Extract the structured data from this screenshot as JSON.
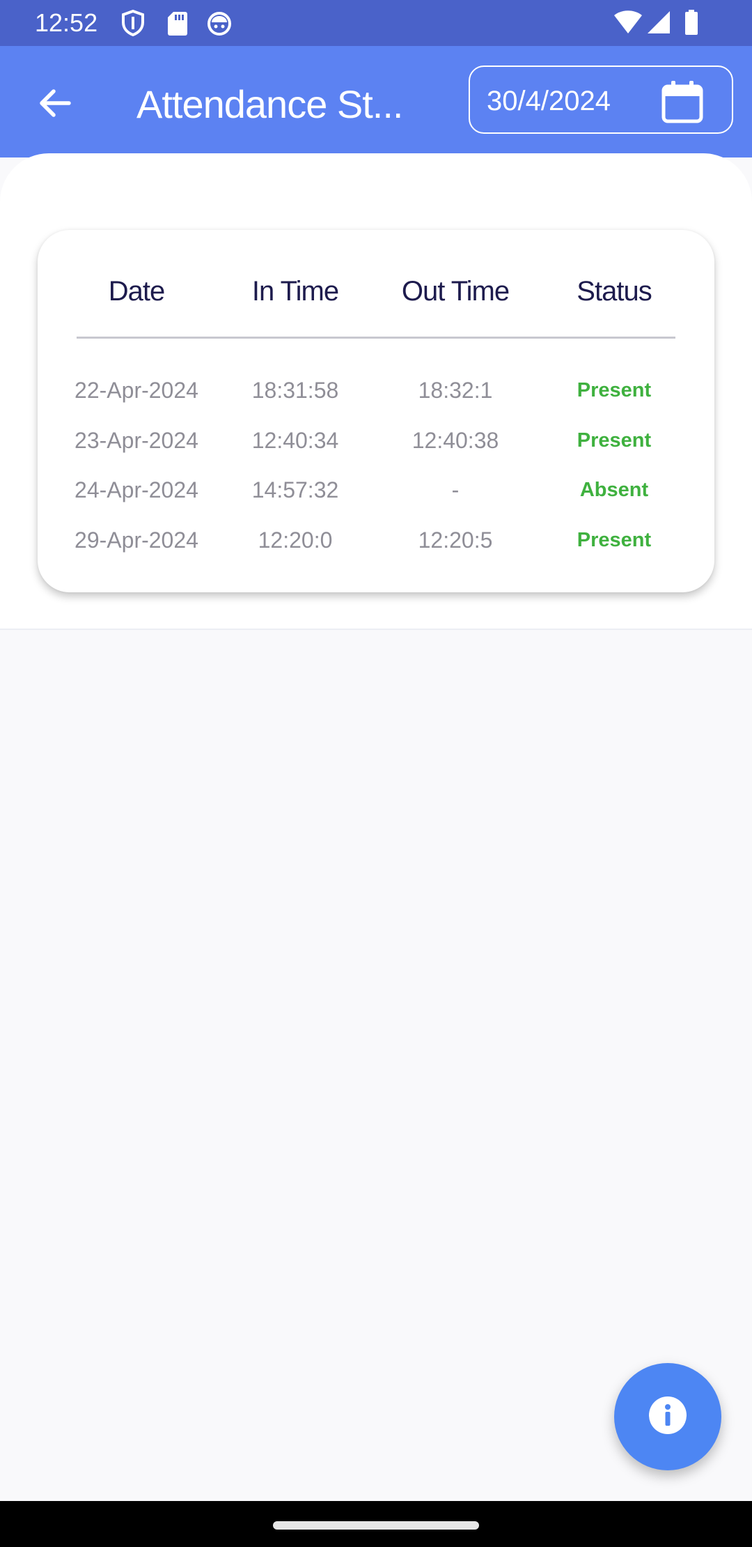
{
  "status_bar": {
    "time": "12:52",
    "icons": [
      "shield-icon",
      "sd-card-icon",
      "android-face-icon",
      "wifi-icon",
      "signal-icon",
      "battery-icon"
    ]
  },
  "app_bar": {
    "back_icon": "arrow-left-icon",
    "title": "Attendance St...",
    "date_value": "30/4/2024",
    "calendar_icon": "calendar-icon",
    "background_color": "#5c82f2"
  },
  "table": {
    "headers": [
      "Date",
      "In Time",
      "Out Time",
      "Status"
    ],
    "rows": [
      {
        "date": "22-Apr-2024",
        "in_time": "18:31:58",
        "out_time": "18:32:1",
        "status": "Present"
      },
      {
        "date": "23-Apr-2024",
        "in_time": "12:40:34",
        "out_time": "12:40:38",
        "status": "Present"
      },
      {
        "date": "24-Apr-2024",
        "in_time": "14:57:32",
        "out_time": "-",
        "status": "Absent"
      },
      {
        "date": "29-Apr-2024",
        "in_time": "12:20:0",
        "out_time": "12:20:5",
        "status": "Present"
      }
    ],
    "status_color": "#3fb13f"
  },
  "fab": {
    "icon": "info-icon",
    "color": "#4d86f3"
  }
}
